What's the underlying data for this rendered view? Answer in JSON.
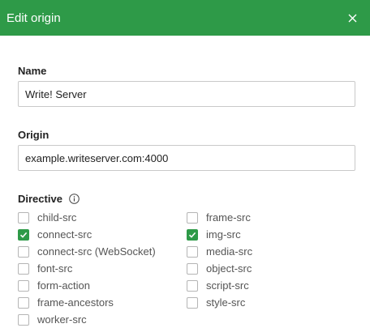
{
  "dialog": {
    "title": "Edit origin",
    "close_icon": "close-icon"
  },
  "colors": {
    "header_bg": "#2e9a48",
    "checkbox_checked": "#2e9a48"
  },
  "name": {
    "label": "Name",
    "value": "Write! Server"
  },
  "origin": {
    "label": "Origin",
    "value": "example.writeserver.com:4000"
  },
  "directive": {
    "label": "Directive",
    "info_icon": "info-icon",
    "items": [
      {
        "label": "child-src",
        "checked": false
      },
      {
        "label": "frame-src",
        "checked": false
      },
      {
        "label": "connect-src",
        "checked": true
      },
      {
        "label": "img-src",
        "checked": true
      },
      {
        "label": "connect-src (WebSocket)",
        "checked": false
      },
      {
        "label": "media-src",
        "checked": false
      },
      {
        "label": "font-src",
        "checked": false
      },
      {
        "label": "object-src",
        "checked": false
      },
      {
        "label": "form-action",
        "checked": false
      },
      {
        "label": "script-src",
        "checked": false
      },
      {
        "label": "frame-ancestors",
        "checked": false
      },
      {
        "label": "style-src",
        "checked": false
      },
      {
        "label": "worker-src",
        "checked": false
      }
    ]
  }
}
